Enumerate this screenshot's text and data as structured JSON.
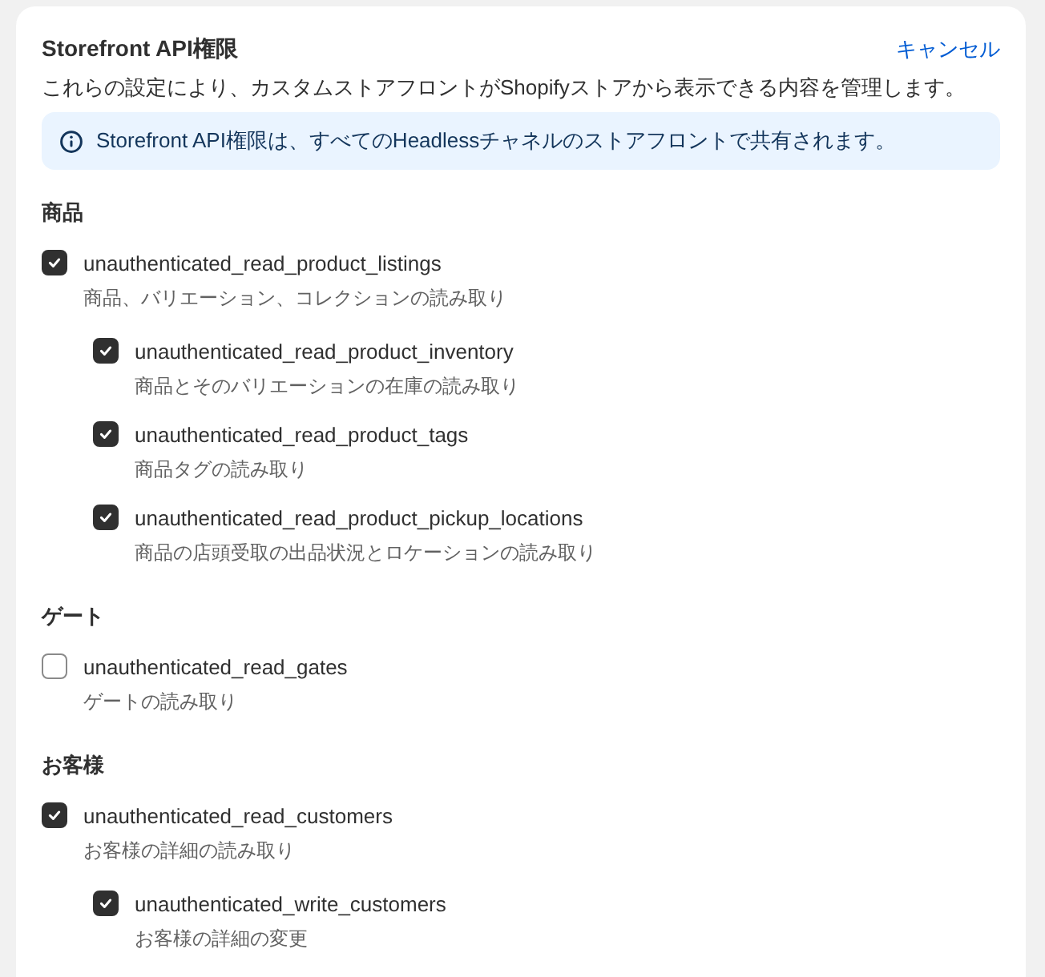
{
  "title": "Storefront API権限",
  "cancel": "キャンセル",
  "description": "これらの設定により、カスタムストアフロントがShopifyストアから表示できる内容を管理します。",
  "info": "Storefront API権限は、すべてのHeadlessチャネルのストアフロントで共有されます。",
  "sections": [
    {
      "heading": "商品",
      "permissions": [
        {
          "name": "unauthenticated_read_product_listings",
          "description": "商品、バリエーション、コレクションの読み取り",
          "checked": true,
          "children": [
            {
              "name": "unauthenticated_read_product_inventory",
              "description": "商品とそのバリエーションの在庫の読み取り",
              "checked": true
            },
            {
              "name": "unauthenticated_read_product_tags",
              "description": "商品タグの読み取り",
              "checked": true
            },
            {
              "name": "unauthenticated_read_product_pickup_locations",
              "description": "商品の店頭受取の出品状況とロケーションの読み取り",
              "checked": true
            }
          ]
        }
      ]
    },
    {
      "heading": "ゲート",
      "permissions": [
        {
          "name": "unauthenticated_read_gates",
          "description": "ゲートの読み取り",
          "checked": false
        }
      ]
    },
    {
      "heading": "お客様",
      "permissions": [
        {
          "name": "unauthenticated_read_customers",
          "description": "お客様の詳細の読み取り",
          "checked": true,
          "children": [
            {
              "name": "unauthenticated_write_customers",
              "description": "お客様の詳細の変更",
              "checked": true
            }
          ]
        }
      ]
    }
  ]
}
